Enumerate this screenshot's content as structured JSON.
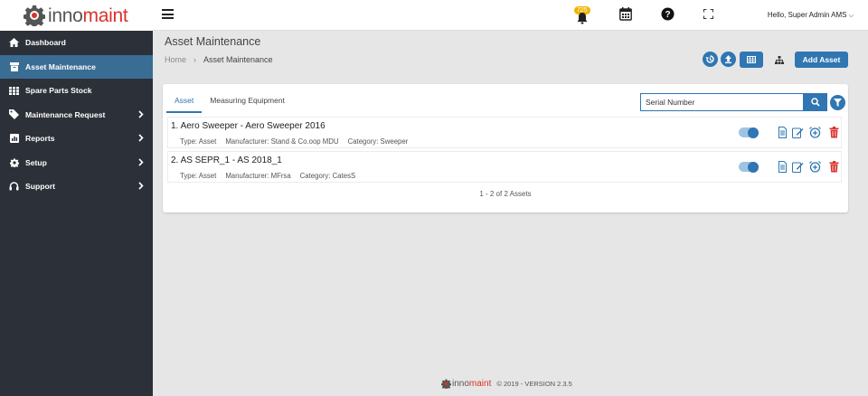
{
  "brand": {
    "part1": "inno",
    "part2": "maint",
    "accent": "#d9322b",
    "primary": "#2f76b2"
  },
  "sidebar": {
    "items": [
      {
        "label": "Dashboard",
        "icon": "home-icon"
      },
      {
        "label": "Asset Maintenance",
        "icon": "box-icon",
        "active": true
      },
      {
        "label": "Spare Parts Stock",
        "icon": "grid-icon"
      },
      {
        "label": "Maintenance Request",
        "icon": "tag-icon",
        "has_children": true
      },
      {
        "label": "Reports",
        "icon": "chart-icon",
        "has_children": true
      },
      {
        "label": "Setup",
        "icon": "gear-icon",
        "has_children": true
      },
      {
        "label": "Support",
        "icon": "headset-icon",
        "has_children": true
      }
    ]
  },
  "topbar": {
    "notification_count": "725",
    "user_greeting": "Hello, Super Admin AMS"
  },
  "header": {
    "title": "Asset Maintenance",
    "breadcrumb": [
      "Home",
      "Asset Maintenance"
    ],
    "add_button": "Add Asset"
  },
  "panel": {
    "tabs": [
      "Asset",
      "Measuring Equipment"
    ],
    "search_value": "Serial Number",
    "rows": [
      {
        "title": "1. Aero Sweeper -  Aero Sweeper 2016",
        "type": "Type: Asset",
        "manufacturer": "Manufacturer: Stand & Co.oop MDU",
        "category": "Category: Sweeper"
      },
      {
        "title": "2. AS SEPR_1 -  AS 2018_1",
        "type": "Type: Asset",
        "manufacturer": "Manufacturer: MFrsa",
        "category": "Category: CatesS"
      }
    ],
    "pagination": "1 - 2 of 2 Assets"
  },
  "footer": {
    "copyright": "© 2019 - VERSION 2.3.5"
  }
}
